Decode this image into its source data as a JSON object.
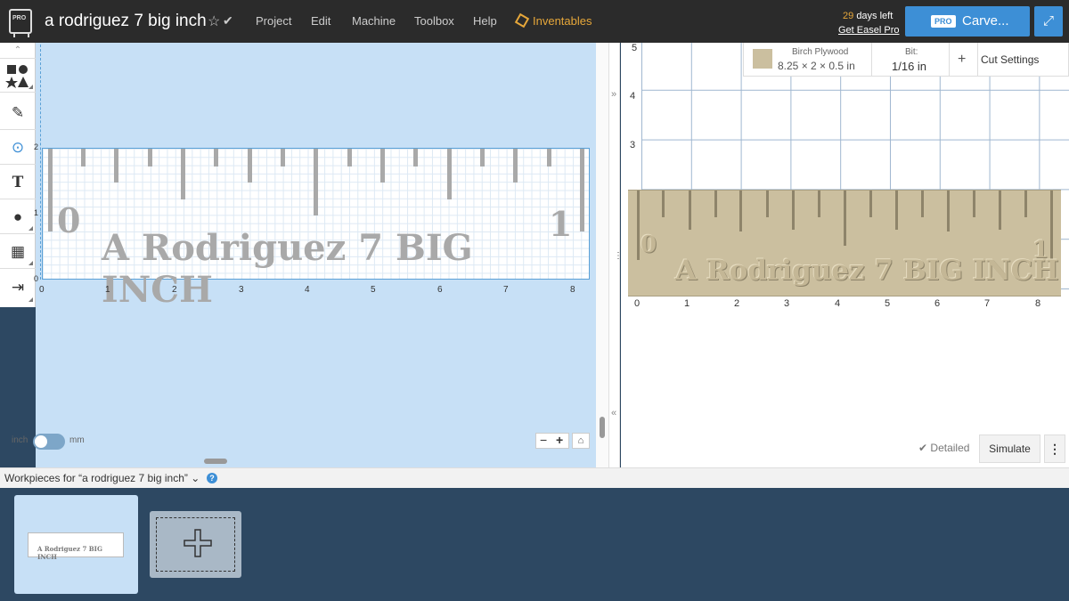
{
  "app": {
    "project_title": "a rodriguez 7 big inch",
    "menu": [
      "Project",
      "Edit",
      "Machine",
      "Toolbox",
      "Help"
    ],
    "inventables_label": "Inventables",
    "trial_days": "29",
    "trial_suffix": "days left",
    "get_pro_label": "Get Easel Pro",
    "carve_badge": "PRO",
    "carve_label": "Carve...",
    "logo_badge": "PRO"
  },
  "design": {
    "ruler_numbers": [
      "0",
      "1"
    ],
    "ruler_text": "A Rodriguez 7 BIG INCH",
    "x_axis_labels": [
      "0",
      "1",
      "2",
      "3",
      "4",
      "5",
      "6",
      "7",
      "8"
    ],
    "y_axis_labels": [
      "2",
      "1",
      "0"
    ],
    "unit_left": "inch",
    "unit_right": "mm",
    "unit_selected": "inch"
  },
  "preview": {
    "material_name": "Birch Plywood",
    "material_size": "8.25 × 2 × 0.5 in",
    "material_color": "#cbbf9f",
    "bit_label": "Bit:",
    "bit_value": "1/16 in",
    "add_label": "+",
    "cut_settings_label": "Cut Settings",
    "y_axis_labels": [
      "5",
      "4",
      "3"
    ],
    "x_axis_labels": [
      "0",
      "1",
      "2",
      "3",
      "4",
      "5",
      "6",
      "7",
      "8"
    ],
    "detailed_label": "Detailed",
    "simulate_label": "Simulate"
  },
  "workpieces": {
    "header": "Workpieces for “a rodriguez 7 big inch”",
    "thumb_text": "A Rodriguez 7 BIG INCH"
  },
  "colors": {
    "accent": "#3d8fd6",
    "inventables": "#e6a73a",
    "canvas_bg": "#c7e0f6",
    "strip_bg": "#2d4862"
  }
}
